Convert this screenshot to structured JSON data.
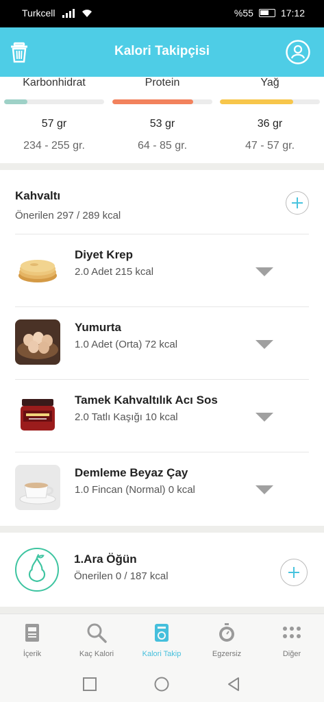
{
  "status_bar": {
    "carrier": "Turkcell",
    "battery": "%55",
    "time": "17:12"
  },
  "header": {
    "title": "Kalori Takipçisi",
    "left_icon": "trash-icon",
    "right_icon": "profile-icon"
  },
  "macros": [
    {
      "name": "Karbonhidrat",
      "amount": "57 gr",
      "range": "234 - 255 gr.",
      "color": "#9ed1c7",
      "fraction": 0.23
    },
    {
      "name": "Protein",
      "amount": "53 gr",
      "range": "64 - 85 gr.",
      "color": "#f2825d",
      "fraction": 0.81
    },
    {
      "name": "Yağ",
      "amount": "36 gr",
      "range": "47 - 57 gr.",
      "color": "#f7c64b",
      "fraction": 0.73
    }
  ],
  "breakfast": {
    "title": "Kahvaltı",
    "subtitle": "Önerilen 297 / 289 kcal",
    "items": [
      {
        "name": "Diyet Krep",
        "amount": "2.0 Adet 215 kcal",
        "image": "crepe"
      },
      {
        "name": "Yumurta",
        "amount": "1.0 Adet (Orta) 72 kcal",
        "image": "eggs"
      },
      {
        "name": "Tamek Kahvaltılık Acı Sos",
        "amount": "2.0 Tatlı Kaşığı 10 kcal",
        "image": "sauce-jar"
      },
      {
        "name": "Demleme Beyaz Çay",
        "amount": "1.0 Fincan (Normal) 0 kcal",
        "image": "tea-cup"
      }
    ]
  },
  "snack": {
    "title": "1.Ara Öğün",
    "subtitle": "Önerilen 0 / 187 kcal",
    "icon": "pear-icon"
  },
  "bottom_nav": [
    {
      "label": "İçerik",
      "icon": "content-icon",
      "active": false
    },
    {
      "label": "Kaç Kalori",
      "icon": "search-icon",
      "active": false
    },
    {
      "label": "Kalori Takip",
      "icon": "scale-icon",
      "active": true
    },
    {
      "label": "Egzersiz",
      "icon": "stopwatch-icon",
      "active": false
    },
    {
      "label": "Diğer",
      "icon": "more-icon",
      "active": false
    }
  ],
  "accent_color": "#4ecde6"
}
